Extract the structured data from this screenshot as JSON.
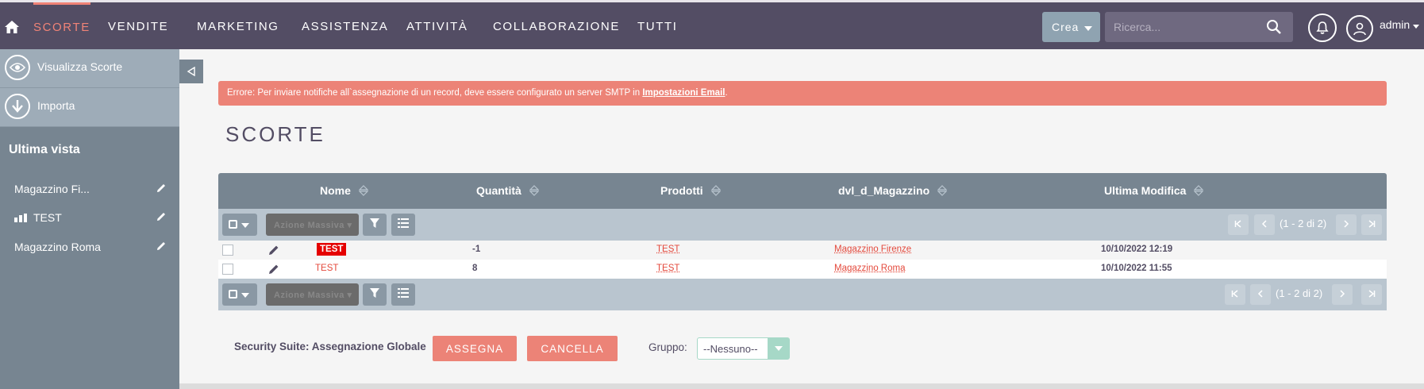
{
  "nav": {
    "items": [
      {
        "label": "SCORTE",
        "active": true
      },
      {
        "label": "VENDITE"
      },
      {
        "label": "MARKETING"
      },
      {
        "label": "ASSISTENZA"
      },
      {
        "label": "ATTIVITÀ"
      },
      {
        "label": "COLLABORAZIONE"
      },
      {
        "label": "TUTTI"
      }
    ],
    "create_label": "Crea",
    "search_placeholder": "Ricerca...",
    "username": "admin"
  },
  "sidebar": {
    "actions": [
      {
        "label": "Visualizza Scorte",
        "icon": "eye-icon"
      },
      {
        "label": "Importa",
        "icon": "download-icon"
      }
    ],
    "recent_title": "Ultima vista",
    "recent": [
      {
        "label": "Magazzino Fi..."
      },
      {
        "label": "TEST"
      },
      {
        "label": "Magazzino Roma"
      }
    ]
  },
  "error": {
    "text": "Errore: Per inviare notifiche all`assegnazione di un record, deve essere configurato un server SMTP in ",
    "link": "Impostazioni Email",
    "suffix": "."
  },
  "page": {
    "title": "SCORTE"
  },
  "table": {
    "columns": [
      "Nome",
      "Quantità",
      "Prodotti",
      "dvl_d_Magazzino",
      "Ultima Modifica"
    ],
    "mass_action": "Azione Massiva",
    "pagination": "(1 - 2 di 2)",
    "rows": [
      {
        "nome": "TEST",
        "quantita": "-1",
        "prodotti": "TEST",
        "magazzino": "Magazzino Firenze",
        "modifica": "10/10/2022 12:19"
      },
      {
        "nome": "TEST",
        "quantita": "8",
        "prodotti": "TEST",
        "magazzino": "Magazzino Roma",
        "modifica": "10/10/2022 11:55"
      }
    ]
  },
  "security": {
    "label": "Security Suite: Assegnazione Globale",
    "assign": "ASSEGNA",
    "cancel": "CANCELLA",
    "group_label": "Gruppo:",
    "group_value": "--Nessuno--"
  },
  "colors": {
    "nav_bg": "#534d64",
    "accent": "#f08377",
    "sidebar": "#778591",
    "error": "#ec8377",
    "link": "#e4493c",
    "badge": "#e50000"
  }
}
